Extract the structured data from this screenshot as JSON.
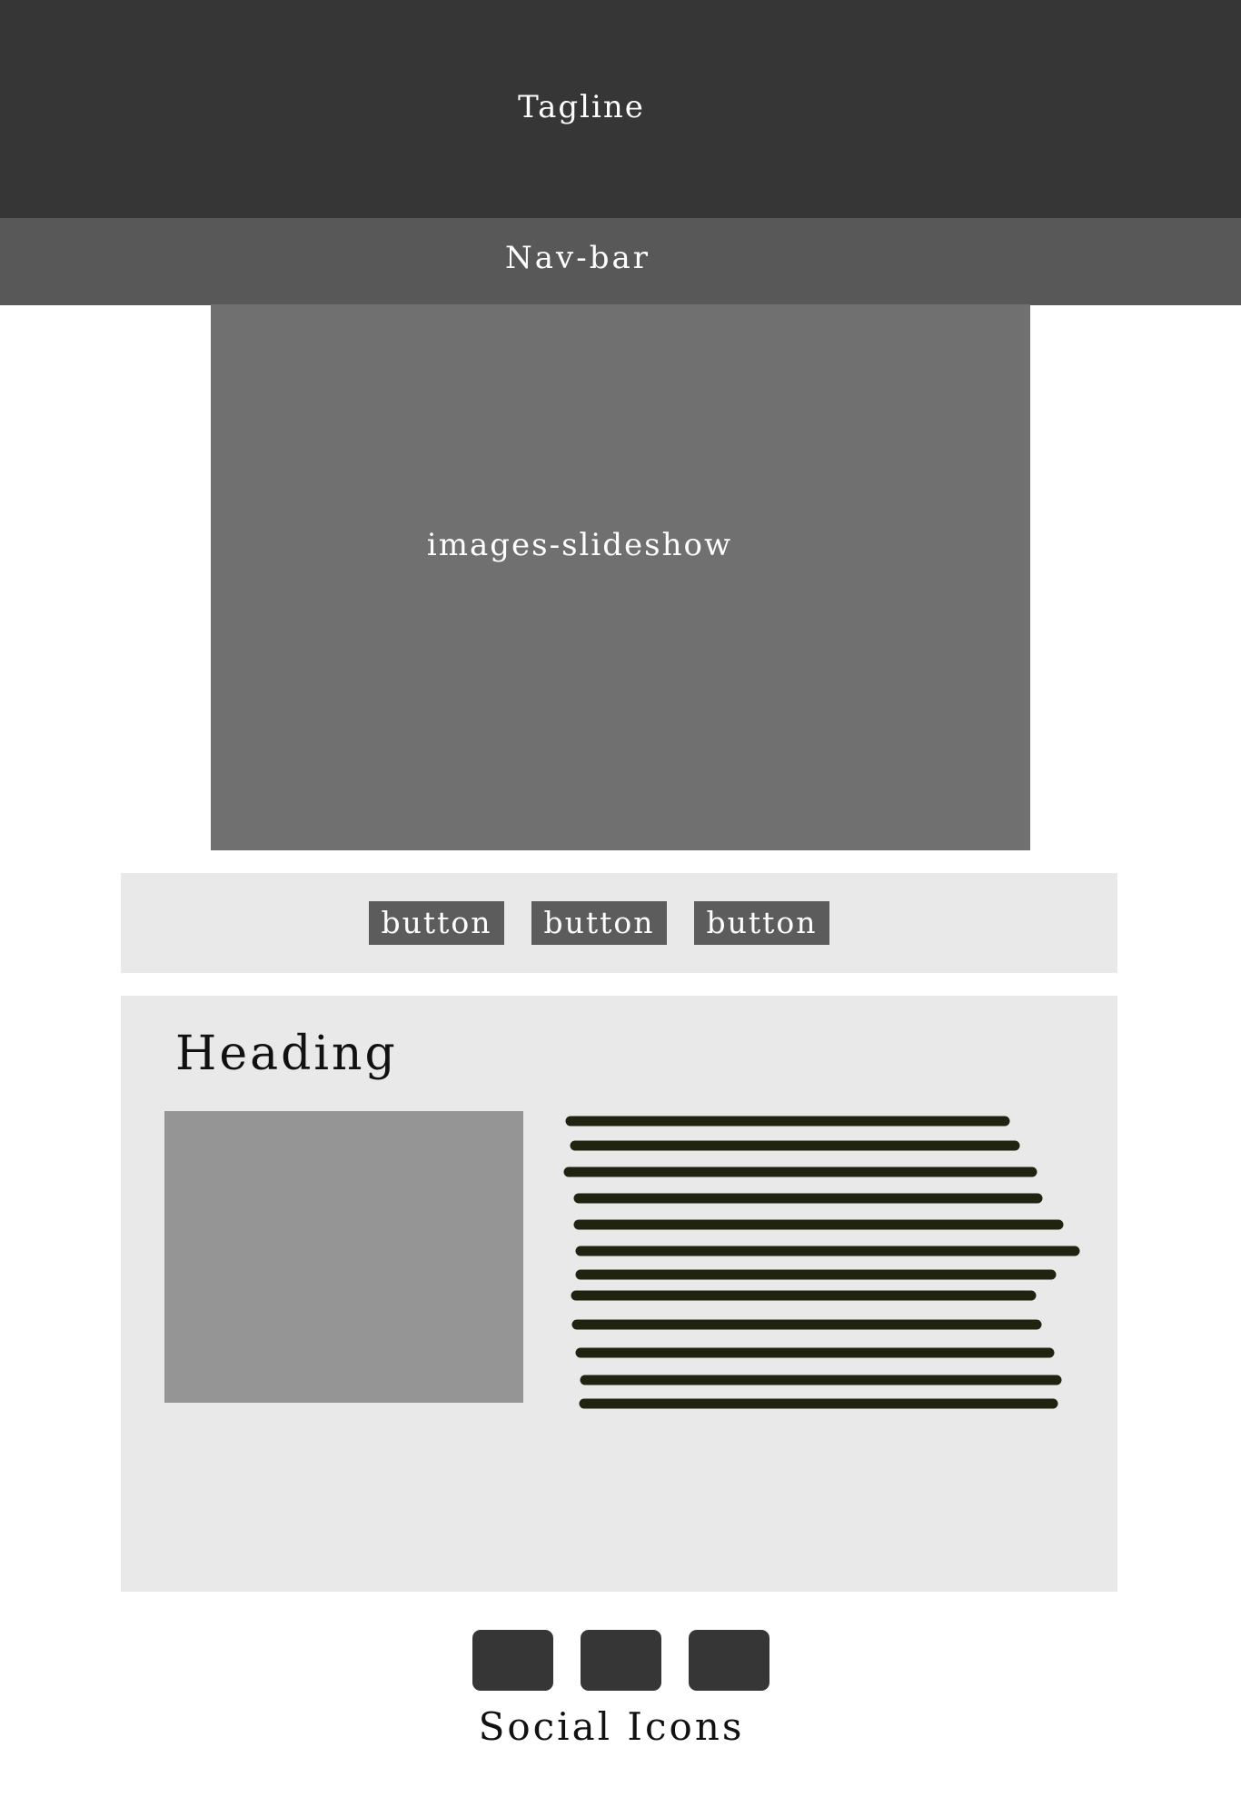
{
  "header": {
    "tagline": "Tagline"
  },
  "navbar": {
    "label": "Nav-bar"
  },
  "slideshow": {
    "label": "images-slideshow"
  },
  "button_bar": {
    "buttons": [
      {
        "label": "button"
      },
      {
        "label": "button"
      },
      {
        "label": "button"
      }
    ]
  },
  "content": {
    "heading": "Heading",
    "paragraph_placeholder_lines": 12
  },
  "social": {
    "label": "Social Icons",
    "icons": [
      "social-icon",
      "social-icon",
      "social-icon"
    ]
  },
  "colors": {
    "header_bg": "#363636",
    "navbar_bg": "#585858",
    "slideshow_bg": "#707070",
    "panel_bg": "#e9e9e9",
    "button_bg": "#5c5c5c",
    "image_placeholder_bg": "#959595",
    "text_line": "#1f2310"
  }
}
